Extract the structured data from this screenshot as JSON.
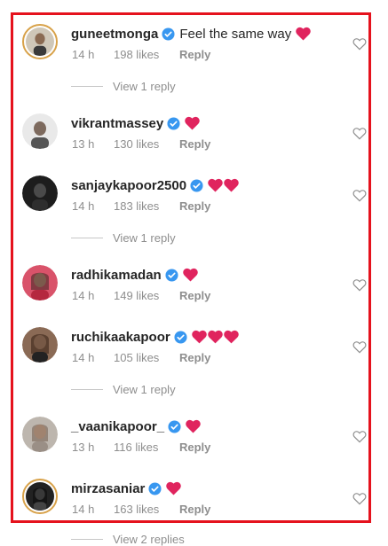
{
  "comments": [
    {
      "username": "guneetmonga",
      "text": "Feel the same way",
      "hearts": 1,
      "time": "14 h",
      "likes": "198 likes",
      "reply": "Reply",
      "view_replies": "View 1 reply",
      "avatar": "story-ring"
    },
    {
      "username": "vikrantmassey",
      "text": "",
      "hearts": 1,
      "time": "13 h",
      "likes": "130 likes",
      "reply": "Reply",
      "view_replies": ""
    },
    {
      "username": "sanjaykapoor2500",
      "text": "",
      "hearts": 2,
      "time": "14 h",
      "likes": "183 likes",
      "reply": "Reply",
      "view_replies": "View 1 reply"
    },
    {
      "username": "radhikamadan",
      "text": "",
      "hearts": 1,
      "time": "14 h",
      "likes": "149 likes",
      "reply": "Reply",
      "view_replies": ""
    },
    {
      "username": "ruchikaakapoor",
      "text": "",
      "hearts": 3,
      "time": "14 h",
      "likes": "105 likes",
      "reply": "Reply",
      "view_replies": "View 1 reply"
    },
    {
      "username": "_vaanikapoor_",
      "text": "",
      "hearts": 1,
      "time": "13 h",
      "likes": "116 likes",
      "reply": "Reply",
      "view_replies": ""
    },
    {
      "username": "mirzasaniar",
      "text": "",
      "hearts": 1,
      "time": "14 h",
      "likes": "163 likes",
      "reply": "Reply",
      "view_replies": "View 2 replies",
      "avatar": "story-ring"
    }
  ],
  "icons": {
    "verified": "verified-badge-icon",
    "heart": "red-heart-emoji",
    "like": "heart-outline-icon"
  },
  "colors": {
    "highlight_border": "#e5121d",
    "verified": "#3897f0",
    "heart": "#e0245e",
    "muted": "#8e8e8e"
  }
}
